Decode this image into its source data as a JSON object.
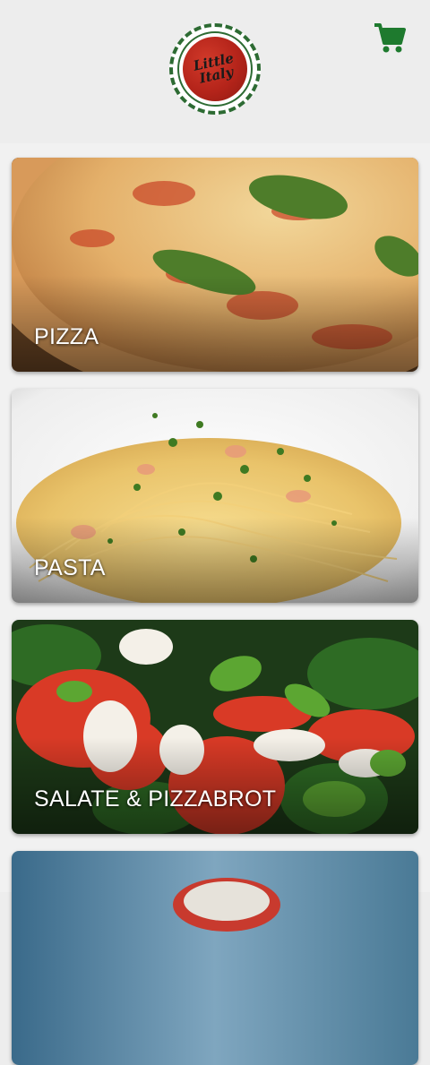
{
  "header": {
    "logo_line1": "Little",
    "logo_line2": "Italy",
    "cart_icon": "shopping-cart-icon",
    "accent_color": "#1e7a2e"
  },
  "categories": [
    {
      "label": "PIZZA"
    },
    {
      "label": "PASTA"
    },
    {
      "label": "SALATE & PIZZABROT"
    },
    {
      "label": ""
    }
  ]
}
